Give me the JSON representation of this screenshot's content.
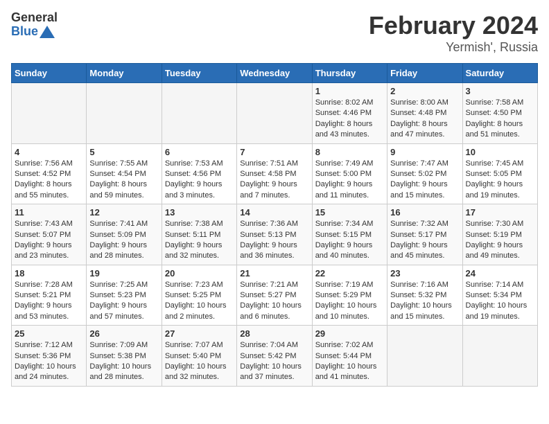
{
  "logo": {
    "text_general": "General",
    "text_blue": "Blue"
  },
  "title": "February 2024",
  "subtitle": "Yermish', Russia",
  "days_of_week": [
    "Sunday",
    "Monday",
    "Tuesday",
    "Wednesday",
    "Thursday",
    "Friday",
    "Saturday"
  ],
  "weeks": [
    [
      {
        "day": "",
        "info": ""
      },
      {
        "day": "",
        "info": ""
      },
      {
        "day": "",
        "info": ""
      },
      {
        "day": "",
        "info": ""
      },
      {
        "day": "1",
        "info": "Sunrise: 8:02 AM\nSunset: 4:46 PM\nDaylight: 8 hours and 43 minutes."
      },
      {
        "day": "2",
        "info": "Sunrise: 8:00 AM\nSunset: 4:48 PM\nDaylight: 8 hours and 47 minutes."
      },
      {
        "day": "3",
        "info": "Sunrise: 7:58 AM\nSunset: 4:50 PM\nDaylight: 8 hours and 51 minutes."
      }
    ],
    [
      {
        "day": "4",
        "info": "Sunrise: 7:56 AM\nSunset: 4:52 PM\nDaylight: 8 hours and 55 minutes."
      },
      {
        "day": "5",
        "info": "Sunrise: 7:55 AM\nSunset: 4:54 PM\nDaylight: 8 hours and 59 minutes."
      },
      {
        "day": "6",
        "info": "Sunrise: 7:53 AM\nSunset: 4:56 PM\nDaylight: 9 hours and 3 minutes."
      },
      {
        "day": "7",
        "info": "Sunrise: 7:51 AM\nSunset: 4:58 PM\nDaylight: 9 hours and 7 minutes."
      },
      {
        "day": "8",
        "info": "Sunrise: 7:49 AM\nSunset: 5:00 PM\nDaylight: 9 hours and 11 minutes."
      },
      {
        "day": "9",
        "info": "Sunrise: 7:47 AM\nSunset: 5:02 PM\nDaylight: 9 hours and 15 minutes."
      },
      {
        "day": "10",
        "info": "Sunrise: 7:45 AM\nSunset: 5:05 PM\nDaylight: 9 hours and 19 minutes."
      }
    ],
    [
      {
        "day": "11",
        "info": "Sunrise: 7:43 AM\nSunset: 5:07 PM\nDaylight: 9 hours and 23 minutes."
      },
      {
        "day": "12",
        "info": "Sunrise: 7:41 AM\nSunset: 5:09 PM\nDaylight: 9 hours and 28 minutes."
      },
      {
        "day": "13",
        "info": "Sunrise: 7:38 AM\nSunset: 5:11 PM\nDaylight: 9 hours and 32 minutes."
      },
      {
        "day": "14",
        "info": "Sunrise: 7:36 AM\nSunset: 5:13 PM\nDaylight: 9 hours and 36 minutes."
      },
      {
        "day": "15",
        "info": "Sunrise: 7:34 AM\nSunset: 5:15 PM\nDaylight: 9 hours and 40 minutes."
      },
      {
        "day": "16",
        "info": "Sunrise: 7:32 AM\nSunset: 5:17 PM\nDaylight: 9 hours and 45 minutes."
      },
      {
        "day": "17",
        "info": "Sunrise: 7:30 AM\nSunset: 5:19 PM\nDaylight: 9 hours and 49 minutes."
      }
    ],
    [
      {
        "day": "18",
        "info": "Sunrise: 7:28 AM\nSunset: 5:21 PM\nDaylight: 9 hours and 53 minutes."
      },
      {
        "day": "19",
        "info": "Sunrise: 7:25 AM\nSunset: 5:23 PM\nDaylight: 9 hours and 57 minutes."
      },
      {
        "day": "20",
        "info": "Sunrise: 7:23 AM\nSunset: 5:25 PM\nDaylight: 10 hours and 2 minutes."
      },
      {
        "day": "21",
        "info": "Sunrise: 7:21 AM\nSunset: 5:27 PM\nDaylight: 10 hours and 6 minutes."
      },
      {
        "day": "22",
        "info": "Sunrise: 7:19 AM\nSunset: 5:29 PM\nDaylight: 10 hours and 10 minutes."
      },
      {
        "day": "23",
        "info": "Sunrise: 7:16 AM\nSunset: 5:32 PM\nDaylight: 10 hours and 15 minutes."
      },
      {
        "day": "24",
        "info": "Sunrise: 7:14 AM\nSunset: 5:34 PM\nDaylight: 10 hours and 19 minutes."
      }
    ],
    [
      {
        "day": "25",
        "info": "Sunrise: 7:12 AM\nSunset: 5:36 PM\nDaylight: 10 hours and 24 minutes."
      },
      {
        "day": "26",
        "info": "Sunrise: 7:09 AM\nSunset: 5:38 PM\nDaylight: 10 hours and 28 minutes."
      },
      {
        "day": "27",
        "info": "Sunrise: 7:07 AM\nSunset: 5:40 PM\nDaylight: 10 hours and 32 minutes."
      },
      {
        "day": "28",
        "info": "Sunrise: 7:04 AM\nSunset: 5:42 PM\nDaylight: 10 hours and 37 minutes."
      },
      {
        "day": "29",
        "info": "Sunrise: 7:02 AM\nSunset: 5:44 PM\nDaylight: 10 hours and 41 minutes."
      },
      {
        "day": "",
        "info": ""
      },
      {
        "day": "",
        "info": ""
      }
    ]
  ]
}
